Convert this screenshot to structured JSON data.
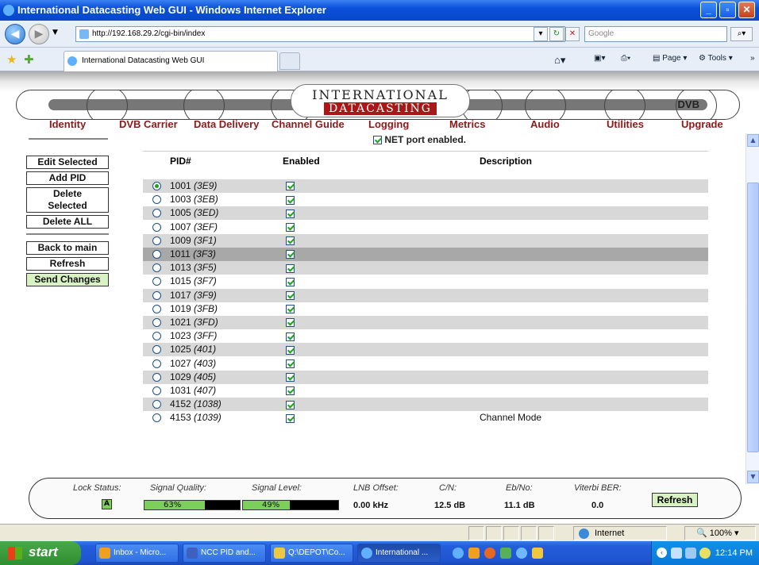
{
  "window": {
    "title": "International Datacasting Web GUI - Windows Internet Explorer"
  },
  "browser": {
    "url": "http://192.168.29.2/cgi-bin/index",
    "search_placeholder": "Google",
    "tab_title": "International Datacasting Web GUI",
    "page_label": "Page",
    "tools_label": "Tools"
  },
  "header": {
    "logo_line1": "INTERNATIONAL",
    "logo_line2": "DATACASTING",
    "logo_right": "DVB",
    "nav": [
      "Identity",
      "DVB Carrier",
      "Data Delivery",
      "Channel Guide",
      "Logging",
      "Metrics",
      "Audio",
      "Utilities",
      "Upgrade"
    ],
    "net_port": "NET port enabled."
  },
  "sidebar": {
    "edit_selected": "Edit Selected",
    "add_pid": "Add PID",
    "delete_selected": "Delete Selected",
    "delete_all": "Delete ALL",
    "back_to_main": "Back to main",
    "refresh": "Refresh",
    "send_changes": "Send Changes"
  },
  "table": {
    "headers": {
      "pid": "PID#",
      "enabled": "Enabled",
      "description": "Description"
    },
    "rows": [
      {
        "pid": "1001",
        "hex": "(3E9)",
        "selected": true,
        "enabled": true,
        "description": ""
      },
      {
        "pid": "1003",
        "hex": "(3EB)",
        "selected": false,
        "enabled": true,
        "description": ""
      },
      {
        "pid": "1005",
        "hex": "(3ED)",
        "selected": false,
        "enabled": true,
        "description": ""
      },
      {
        "pid": "1007",
        "hex": "(3EF)",
        "selected": false,
        "enabled": true,
        "description": ""
      },
      {
        "pid": "1009",
        "hex": "(3F1)",
        "selected": false,
        "enabled": true,
        "description": ""
      },
      {
        "pid": "1011",
        "hex": "(3F3)",
        "selected": false,
        "enabled": true,
        "description": ""
      },
      {
        "pid": "1013",
        "hex": "(3F5)",
        "selected": false,
        "enabled": true,
        "description": ""
      },
      {
        "pid": "1015",
        "hex": "(3F7)",
        "selected": false,
        "enabled": true,
        "description": ""
      },
      {
        "pid": "1017",
        "hex": "(3F9)",
        "selected": false,
        "enabled": true,
        "description": ""
      },
      {
        "pid": "1019",
        "hex": "(3FB)",
        "selected": false,
        "enabled": true,
        "description": ""
      },
      {
        "pid": "1021",
        "hex": "(3FD)",
        "selected": false,
        "enabled": true,
        "description": ""
      },
      {
        "pid": "1023",
        "hex": "(3FF)",
        "selected": false,
        "enabled": true,
        "description": ""
      },
      {
        "pid": "1025",
        "hex": "(401)",
        "selected": false,
        "enabled": true,
        "description": ""
      },
      {
        "pid": "1027",
        "hex": "(403)",
        "selected": false,
        "enabled": true,
        "description": ""
      },
      {
        "pid": "1029",
        "hex": "(405)",
        "selected": false,
        "enabled": true,
        "description": ""
      },
      {
        "pid": "1031",
        "hex": "(407)",
        "selected": false,
        "enabled": true,
        "description": ""
      },
      {
        "pid": "4152",
        "hex": "(1038)",
        "selected": false,
        "enabled": true,
        "description": ""
      },
      {
        "pid": "4153",
        "hex": "(1039)",
        "selected": false,
        "enabled": true,
        "description": "Channel Mode"
      }
    ]
  },
  "status": {
    "lock_label": "Lock Status:",
    "lock_value": "A",
    "quality_label": "Signal Quality:",
    "quality_value": "63%",
    "quality_fraction": 0.63,
    "level_label": "Signal Level:",
    "level_value": "49%",
    "level_fraction": 0.49,
    "lnb_label": "LNB Offset:",
    "lnb_value": "0.00 kHz",
    "cn_label": "C/N:",
    "cn_value": "12.5 dB",
    "ebno_label": "Eb/No:",
    "ebno_value": "11.1 dB",
    "viterbi_label": "Viterbi BER:",
    "viterbi_value": "0.0",
    "refresh": "Refresh"
  },
  "statusbar": {
    "zone": "Internet",
    "zoom": "100%"
  },
  "taskbar": {
    "start": "start",
    "tasks": [
      "Inbox - Micro...",
      "NCC PID and...",
      "Q:\\DEPOT\\Co...",
      "International ..."
    ],
    "clock": "12:14 PM"
  },
  "colors": {
    "nav_link": "#8b1a1a",
    "row_gray": "#d8d8d8",
    "row_selected": "#a8a8a8",
    "green_button": "#d8f2c4",
    "signal_green": "#7ccf5a"
  }
}
